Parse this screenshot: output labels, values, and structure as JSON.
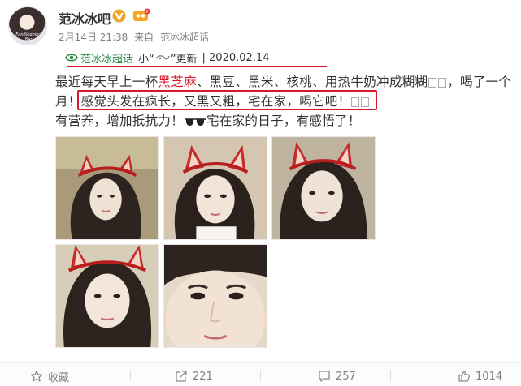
{
  "author": {
    "name": "范冰冰吧",
    "avatar_signature": "FanBingbing Bar"
  },
  "meta": {
    "time": "2月14日 21:38",
    "source_prefix": "来自",
    "source": "范冰冰超话"
  },
  "topic": {
    "super_topic": "范冰冰超话",
    "prefix": "小“",
    "suffix": "”更新",
    "date": "| 2020.02.14"
  },
  "post": {
    "line1_a": "最近每天早上一杯",
    "line1_highlight": "黑芝麻",
    "line1_b": "、黑豆、黑米、核桃、用热牛奶冲成糊糊",
    "line1_c": "，喝了一个",
    "line2_a": "月！",
    "line2_b": "感觉头发在疯长，又黑又粗，宅在家，喝它吧！",
    "line3_a": "有营养，增加抵抗力！",
    "line3_b": "宅在家的日子，有感悟了！"
  },
  "footer": {
    "favorite_label": "收藏",
    "repost_count": "221",
    "comment_count": "257",
    "like_count": "1014"
  },
  "colors": {
    "red_accent": "#d8182a",
    "topic_green": "#2a8a4a",
    "verify_orange": "#f1a325"
  }
}
